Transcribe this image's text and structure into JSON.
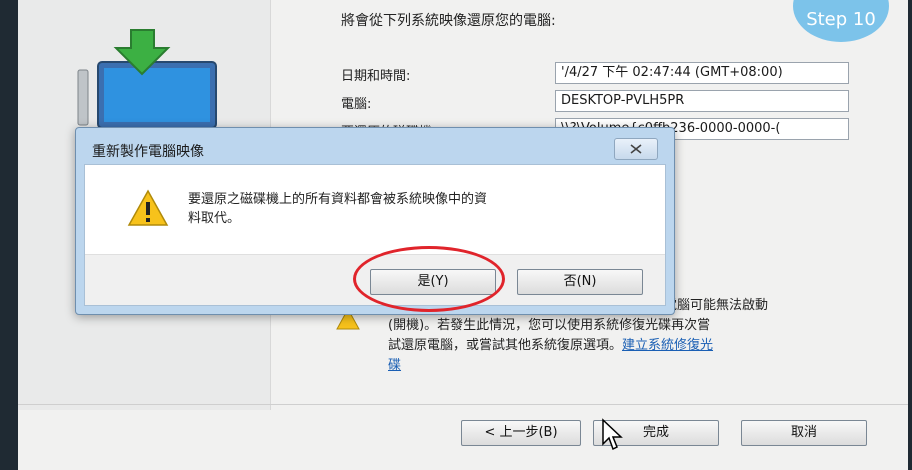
{
  "wizard": {
    "heading": "將會從下列系統映像還原您的電腦:",
    "fields": [
      {
        "label": "日期和時間:",
        "value": "'/4/27 下午 02:47:44 (GMT+08:00)"
      },
      {
        "label": "電腦:",
        "value": "DESKTOP-PVLH5PR"
      },
      {
        "label": "要還原的磁碟機:",
        "value": "\\\\?\\Volume{c0ffb236-0000-0000-("
      }
    ],
    "warning": {
      "line1": "電腦可能無法啟動",
      "line2": "(開機)。若發生此情況，您可以使用系統修復光碟再次嘗",
      "line3": "試還原電腦，或嘗試其他系統復原選項。",
      "link": "建立系統修復光",
      "line4": "碟"
    },
    "buttons": {
      "back": "< 上一步(B)",
      "finish": "完成",
      "cancel": "取消"
    }
  },
  "dialog": {
    "title": "重新製作電腦映像",
    "message_line1": "要還原之磁碟機上的所有資料都會被系統映像中的資",
    "message_line2": "料取代。",
    "yes_label": "是(Y)",
    "no_label": "否(N)"
  },
  "overlay": {
    "badge_text": "Step 10",
    "ring_color": "#e0242b"
  },
  "colors": {
    "dialog_frame": "#bcd6ee",
    "link": "#1a5fb4",
    "warning_yellow": "#f7c21b"
  }
}
